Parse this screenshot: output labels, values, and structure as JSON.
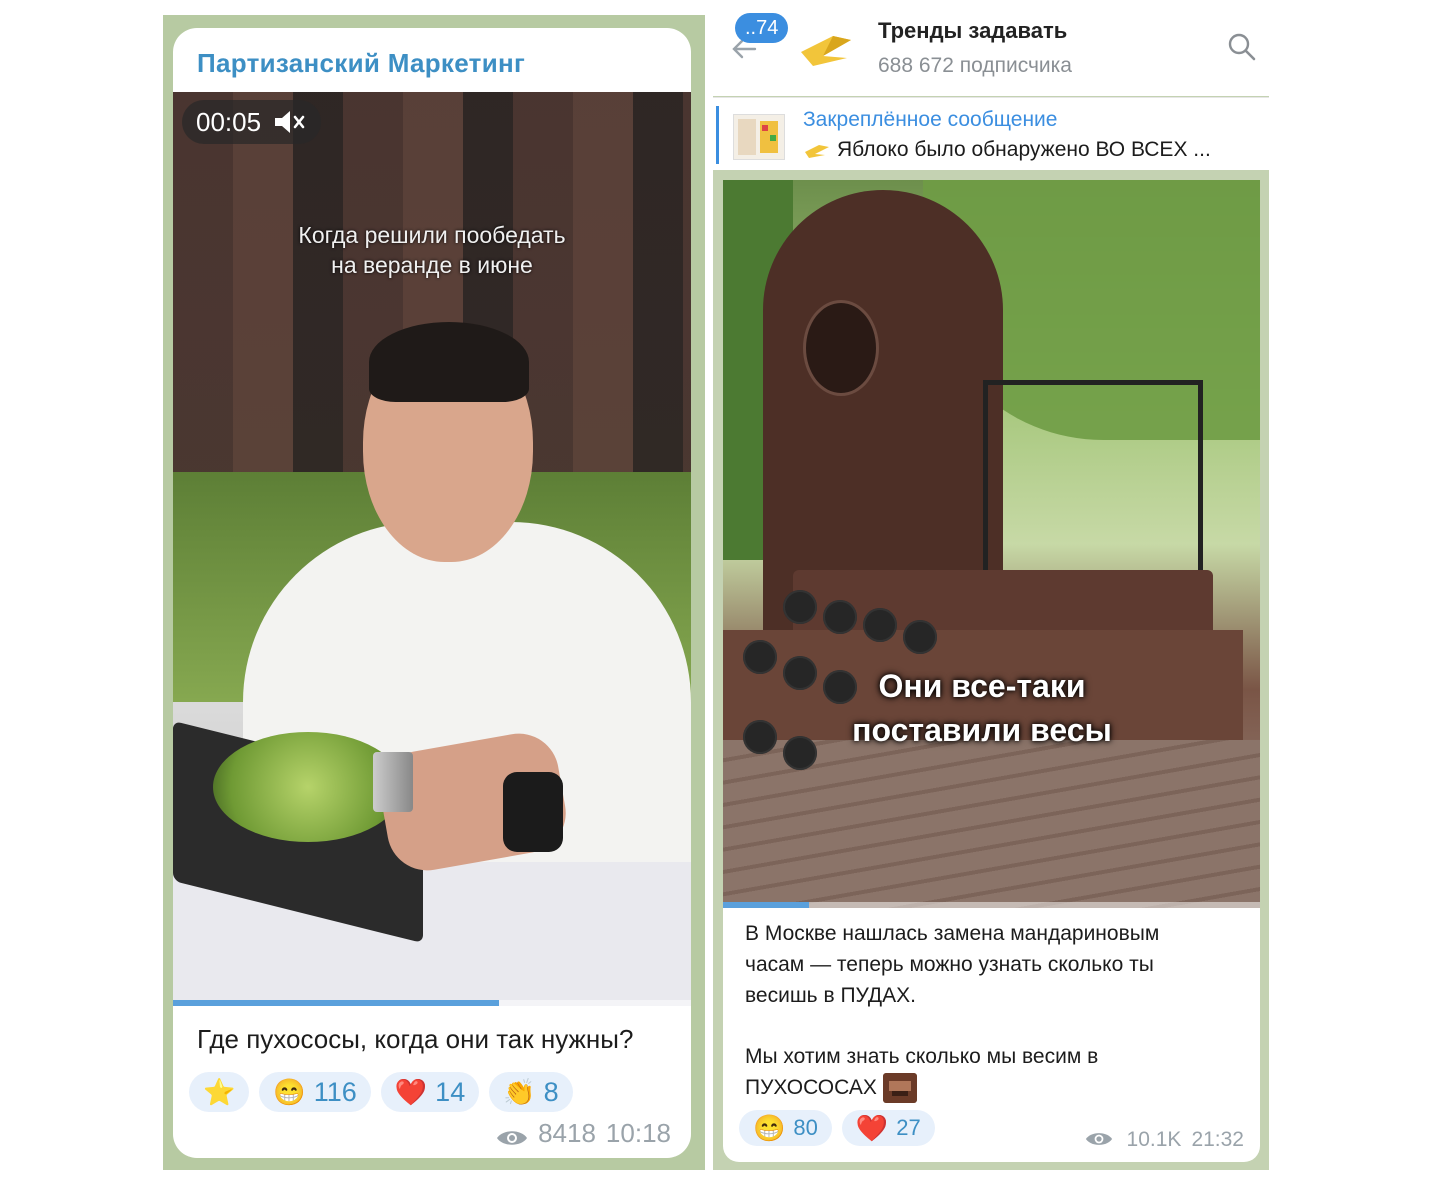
{
  "left_post": {
    "channel_name": "Партизанский Маркетинг",
    "video": {
      "timestamp": "00:05",
      "caption_line1": "Когда решили пообедать",
      "caption_line2": "на веранде в июне",
      "progress": 0.63
    },
    "text": "Где пухососы, когда они так нужны?",
    "reactions": [
      {
        "emoji": "⭐",
        "count": ""
      },
      {
        "emoji": "😁",
        "count": "116"
      },
      {
        "emoji": "❤️",
        "count": "14"
      },
      {
        "emoji": "👏",
        "count": "8"
      }
    ],
    "views": "8418",
    "time": "10:18"
  },
  "right_post": {
    "header": {
      "unread_count": "..74",
      "channel_name": "Тренды задавать",
      "subscribers": "688 672 подписчика"
    },
    "pinned": {
      "title": "Закреплённое сообщение",
      "text": "Яблоко было обнаружено ВО ВСЕХ ..."
    },
    "video": {
      "caption_line1": "Они все-таки",
      "caption_line2": "поставили весы",
      "progress": 0.16
    },
    "text_lines": [
      "В Москве нашлась замена мандариновым",
      "часам — теперь можно узнать сколько ты",
      "весишь в ПУДАХ.",
      "Мы хотим знать сколько мы весим в",
      "ПУХОСОСАХ"
    ],
    "reactions": [
      {
        "emoji": "😁",
        "count": "80"
      },
      {
        "emoji": "❤️",
        "count": "27"
      }
    ],
    "views": "10.1K",
    "time": "21:32"
  },
  "colors": {
    "link_blue": "#3d8fc4",
    "reaction_bg": "#e7f0fb",
    "meta_gray": "#9aa3aa",
    "badge_blue": "#3b8ee0"
  }
}
